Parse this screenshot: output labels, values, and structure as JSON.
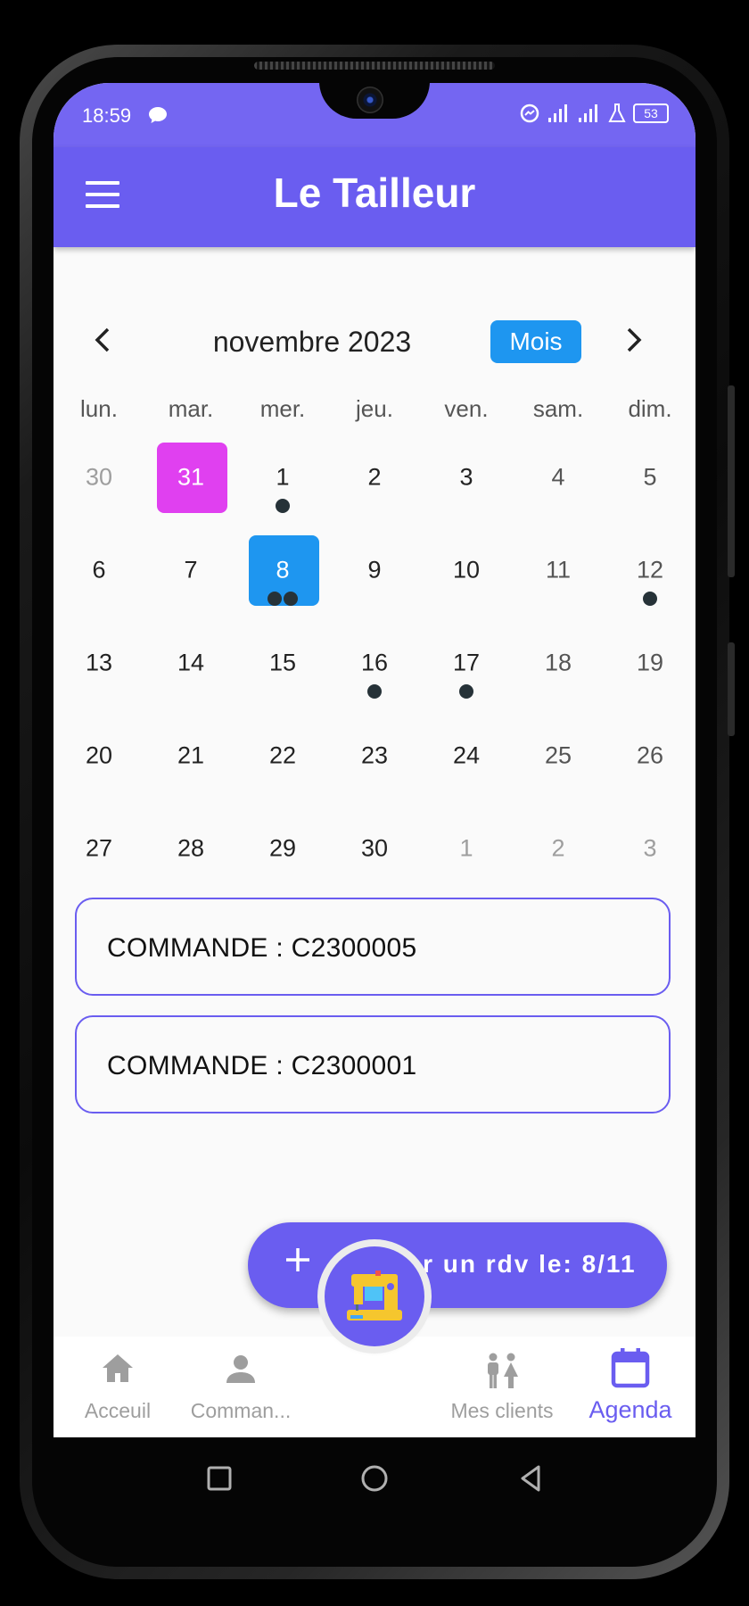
{
  "status_bar": {
    "time": "18:59",
    "battery": "53"
  },
  "app_bar": {
    "title": "Le Tailleur"
  },
  "calendar": {
    "month_title": "novembre 2023",
    "format_button": "Mois",
    "days_of_week": [
      "lun.",
      "mar.",
      "mer.",
      "jeu.",
      "ven.",
      "sam.",
      "dim."
    ],
    "weeks": [
      [
        {
          "d": "30",
          "other": true
        },
        {
          "d": "31",
          "today": true
        },
        {
          "d": "1",
          "markers": 1
        },
        {
          "d": "2"
        },
        {
          "d": "3"
        },
        {
          "d": "4",
          "weekend": true
        },
        {
          "d": "5",
          "weekend": true
        }
      ],
      [
        {
          "d": "6"
        },
        {
          "d": "7"
        },
        {
          "d": "8",
          "selected": true,
          "markers": 2
        },
        {
          "d": "9"
        },
        {
          "d": "10"
        },
        {
          "d": "11",
          "weekend": true
        },
        {
          "d": "12",
          "weekend": true,
          "markers": 1
        }
      ],
      [
        {
          "d": "13"
        },
        {
          "d": "14"
        },
        {
          "d": "15"
        },
        {
          "d": "16",
          "markers": 1
        },
        {
          "d": "17",
          "markers": 1
        },
        {
          "d": "18",
          "weekend": true
        },
        {
          "d": "19",
          "weekend": true
        }
      ],
      [
        {
          "d": "20"
        },
        {
          "d": "21"
        },
        {
          "d": "22"
        },
        {
          "d": "23"
        },
        {
          "d": "24"
        },
        {
          "d": "25",
          "weekend": true
        },
        {
          "d": "26",
          "weekend": true
        }
      ],
      [
        {
          "d": "27"
        },
        {
          "d": "28"
        },
        {
          "d": "29"
        },
        {
          "d": "30"
        },
        {
          "d": "1",
          "other": true
        },
        {
          "d": "2",
          "other": true
        },
        {
          "d": "3",
          "other": true
        }
      ]
    ]
  },
  "events": [
    {
      "label": "COMMANDE : C2300005"
    },
    {
      "label": "COMMANDE : C2300001"
    }
  ],
  "fab": {
    "label": "Ajouter un rdv le: 8/11",
    "icon": "plus-icon"
  },
  "bottom_nav": {
    "items": [
      {
        "label": "Acceuil",
        "icon": "home-icon"
      },
      {
        "label": "Comman...",
        "icon": "person-icon"
      },
      {
        "label": "Mes clients",
        "icon": "people-icon"
      },
      {
        "label": "Agenda",
        "icon": "calendar-icon",
        "active": true
      }
    ],
    "center_icon": "sewing-machine-icon"
  },
  "colors": {
    "primary": "#6a5df0",
    "today": "#e040f0",
    "selected": "#1e96f0",
    "marker": "#263238"
  }
}
